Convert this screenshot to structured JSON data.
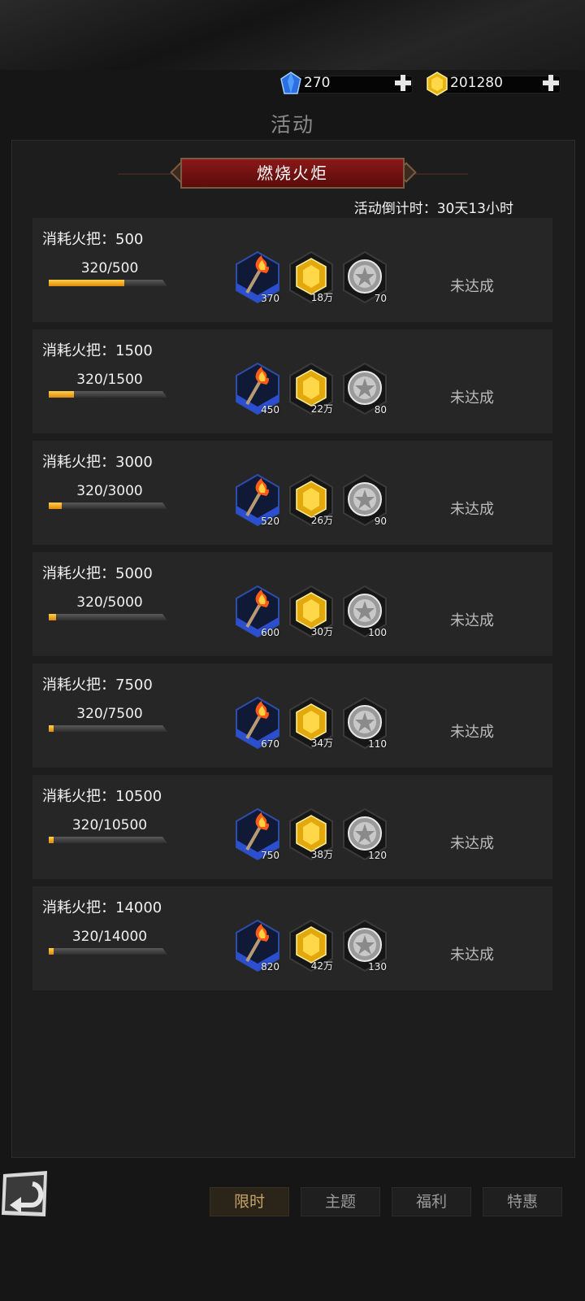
{
  "header": {
    "diamonds": "270",
    "gold": "201280",
    "title": "活动"
  },
  "banner": {
    "title": "燃烧火炬",
    "countdown": "活动倒计时：30天13小时"
  },
  "tiers": [
    {
      "requirement": "消耗火把：500",
      "progress_text": "320/500",
      "progress": 0.64,
      "rewards": [
        "370",
        "18万",
        "70"
      ],
      "status": "未达成"
    },
    {
      "requirement": "消耗火把：1500",
      "progress_text": "320/1500",
      "progress": 0.213,
      "rewards": [
        "450",
        "22万",
        "80"
      ],
      "status": "未达成"
    },
    {
      "requirement": "消耗火把：3000",
      "progress_text": "320/3000",
      "progress": 0.107,
      "rewards": [
        "520",
        "26万",
        "90"
      ],
      "status": "未达成"
    },
    {
      "requirement": "消耗火把：5000",
      "progress_text": "320/5000",
      "progress": 0.064,
      "rewards": [
        "600",
        "30万",
        "100"
      ],
      "status": "未达成"
    },
    {
      "requirement": "消耗火把：7500",
      "progress_text": "320/7500",
      "progress": 0.043,
      "rewards": [
        "670",
        "34万",
        "110"
      ],
      "status": "未达成"
    },
    {
      "requirement": "消耗火把：10500",
      "progress_text": "320/10500",
      "progress": 0.03,
      "rewards": [
        "750",
        "38万",
        "120"
      ],
      "status": "未达成"
    },
    {
      "requirement": "消耗火把：14000",
      "progress_text": "320/14000",
      "progress": 0.023,
      "rewards": [
        "820",
        "42万",
        "130"
      ],
      "status": "未达成"
    }
  ],
  "reward_icons": [
    "torch-icon",
    "gold-gem-icon",
    "silver-coin-icon"
  ],
  "tabs": [
    {
      "label": "限时",
      "active": true
    },
    {
      "label": "主题",
      "active": false
    },
    {
      "label": "福利",
      "active": false
    },
    {
      "label": "特惠",
      "active": false
    }
  ],
  "colors": {
    "progress_fill": "#f0a820",
    "banner_red": "#7a1212",
    "active_tab_text": "#c6a26a"
  }
}
